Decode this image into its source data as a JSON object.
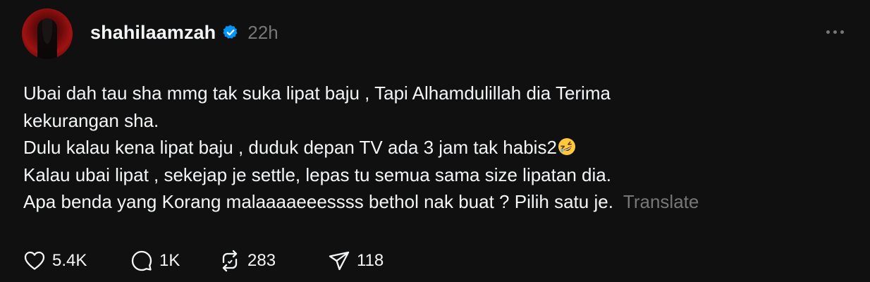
{
  "post": {
    "username": "shahilaamzah",
    "time": "22h",
    "verified_color": "#0095f6",
    "avatar_icon": "profile-photo",
    "more_icon": "ellipsis-icon",
    "lines": [
      "Ubai dah tau sha mmg tak suka lipat baju , Tapi Alhamdulillah dia Terima",
      "kekurangan sha.",
      "Dulu kalau kena lipat baju , duduk depan TV ada 3 jam tak habis2",
      "Kalau ubai lipat , sekejap je settle, lepas tu semua sama size lipatan dia.",
      "Apa benda yang Korang malaaaaeeessss bethol nak buat ? Pilih satu je."
    ],
    "emoji": "rolling-on-floor-laughing",
    "translate_label": "Translate"
  },
  "actions": {
    "likes": "5.4K",
    "replies": "1K",
    "reposts": "283",
    "shares": "118"
  },
  "colors": {
    "background": "#101010",
    "text": "#f3f5f7",
    "muted": "#777777"
  }
}
